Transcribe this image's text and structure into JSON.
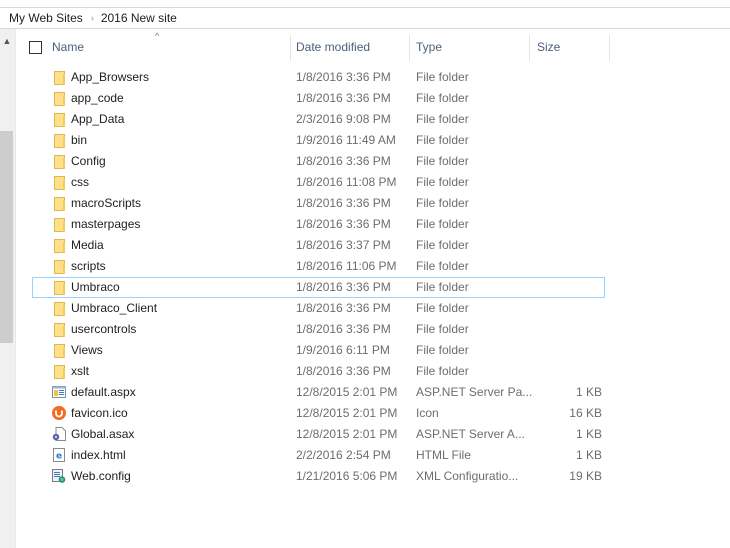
{
  "breadcrumb": [
    "My Web Sites",
    "2016 New site"
  ],
  "columns": {
    "name": "Name",
    "date_modified": "Date modified",
    "type": "Type",
    "size": "Size",
    "sort_indicator": "^"
  },
  "colors": {
    "folder": "#ffe08a",
    "focus_outline": "#99d1ff",
    "header_text": "#4c607a",
    "favicon": "#f26b21"
  },
  "files": [
    {
      "name": "App_Browsers",
      "date": "1/8/2016 3:36 PM",
      "type": "File folder",
      "size": "",
      "icon": "folder-icon"
    },
    {
      "name": "app_code",
      "date": "1/8/2016 3:36 PM",
      "type": "File folder",
      "size": "",
      "icon": "folder-icon"
    },
    {
      "name": "App_Data",
      "date": "2/3/2016 9:08 PM",
      "type": "File folder",
      "size": "",
      "icon": "folder-icon"
    },
    {
      "name": "bin",
      "date": "1/9/2016 11:49 AM",
      "type": "File folder",
      "size": "",
      "icon": "folder-icon"
    },
    {
      "name": "Config",
      "date": "1/8/2016 3:36 PM",
      "type": "File folder",
      "size": "",
      "icon": "folder-icon"
    },
    {
      "name": "css",
      "date": "1/8/2016 11:08 PM",
      "type": "File folder",
      "size": "",
      "icon": "folder-icon"
    },
    {
      "name": "macroScripts",
      "date": "1/8/2016 3:36 PM",
      "type": "File folder",
      "size": "",
      "icon": "folder-icon"
    },
    {
      "name": "masterpages",
      "date": "1/8/2016 3:36 PM",
      "type": "File folder",
      "size": "",
      "icon": "folder-icon"
    },
    {
      "name": "Media",
      "date": "1/8/2016 3:37 PM",
      "type": "File folder",
      "size": "",
      "icon": "folder-icon"
    },
    {
      "name": "scripts",
      "date": "1/8/2016 11:06 PM",
      "type": "File folder",
      "size": "",
      "icon": "folder-icon"
    },
    {
      "name": "Umbraco",
      "date": "1/8/2016 3:36 PM",
      "type": "File folder",
      "size": "",
      "icon": "folder-icon",
      "focused": true
    },
    {
      "name": "Umbraco_Client",
      "date": "1/8/2016 3:36 PM",
      "type": "File folder",
      "size": "",
      "icon": "folder-icon"
    },
    {
      "name": "usercontrols",
      "date": "1/8/2016 3:36 PM",
      "type": "File folder",
      "size": "",
      "icon": "folder-icon"
    },
    {
      "name": "Views",
      "date": "1/9/2016 6:11 PM",
      "type": "File folder",
      "size": "",
      "icon": "folder-icon"
    },
    {
      "name": "xslt",
      "date": "1/8/2016 3:36 PM",
      "type": "File folder",
      "size": "",
      "icon": "folder-icon"
    },
    {
      "name": "default.aspx",
      "date": "12/8/2015 2:01 PM",
      "type": "ASP.NET Server Pa...",
      "size": "1 KB",
      "icon": "aspx-file-icon"
    },
    {
      "name": "favicon.ico",
      "date": "12/8/2015 2:01 PM",
      "type": "Icon",
      "size": "16 KB",
      "icon": "umbraco-favicon-icon"
    },
    {
      "name": "Global.asax",
      "date": "12/8/2015 2:01 PM",
      "type": "ASP.NET Server A...",
      "size": "1 KB",
      "icon": "asax-file-icon"
    },
    {
      "name": "index.html",
      "date": "2/2/2016 2:54 PM",
      "type": "HTML File",
      "size": "1 KB",
      "icon": "html-file-icon"
    },
    {
      "name": "Web.config",
      "date": "1/21/2016 5:06 PM",
      "type": "XML Configuratio...",
      "size": "19 KB",
      "icon": "config-file-icon"
    }
  ]
}
